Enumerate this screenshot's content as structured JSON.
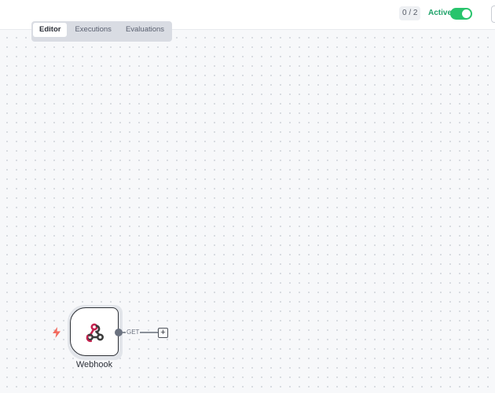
{
  "header": {
    "counter": "0 / 2",
    "active_label": "Active",
    "active": true
  },
  "tabs": [
    {
      "label": "Editor",
      "active": true
    },
    {
      "label": "Executions",
      "active": false
    },
    {
      "label": "Evaluations",
      "active": false
    }
  ],
  "node": {
    "label": "Webhook",
    "icon": "webhook-icon",
    "trigger_icon": "lightning-bolt-icon",
    "output_label": "GET"
  },
  "colors": {
    "accent_green": "#28c46c",
    "trigger_orange": "#f26a5e",
    "webhook_red": "#c4214e",
    "webhook_dark": "#3b3b3b"
  },
  "add_button": "+"
}
